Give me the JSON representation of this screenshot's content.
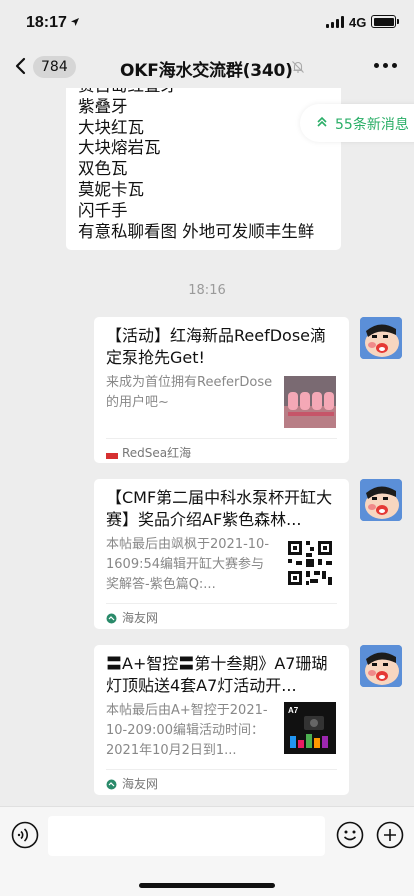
{
  "status_bar": {
    "time": "18:17",
    "network": "4G",
    "battery_level": 1.0
  },
  "nav": {
    "unread_count": "784",
    "title": "OKF海水交流群(340)"
  },
  "new_messages": {
    "label": "55条新消息"
  },
  "text_message": {
    "lines": [
      "赛古岛红叠牙",
      "紫叠牙",
      "大块红瓦",
      "大块熔岩瓦",
      "双色瓦",
      "莫妮卡瓦",
      "闪千手",
      "有意私聊看图 外地可发顺丰生鲜"
    ]
  },
  "time_separator": "18:16",
  "cards": [
    {
      "title": "【活动】红海新品ReefDose滴定泵抢先Get!",
      "desc": "来成为首位拥有ReeferDose的用户吧~",
      "source": "RedSea红海"
    },
    {
      "title": "【CMF第二届中科水泵杯开缸大赛】奖品介绍AF紫色森林...",
      "desc": "本帖最后由飒枫于2021-10-1609:54编辑开缸大赛参与奖解答-紫色篇Q:...",
      "source": "海友网"
    },
    {
      "title": "〓A+智控〓第十叁期》A7珊瑚灯顶贴送4套A7灯活动开...",
      "desc": "本帖最后由A+智控于2021-10-209:00编辑活动时间：2021年10月2日到1...",
      "source": "海友网"
    }
  ],
  "colors": {
    "accent": "#2aae67",
    "background": "#ededed"
  }
}
